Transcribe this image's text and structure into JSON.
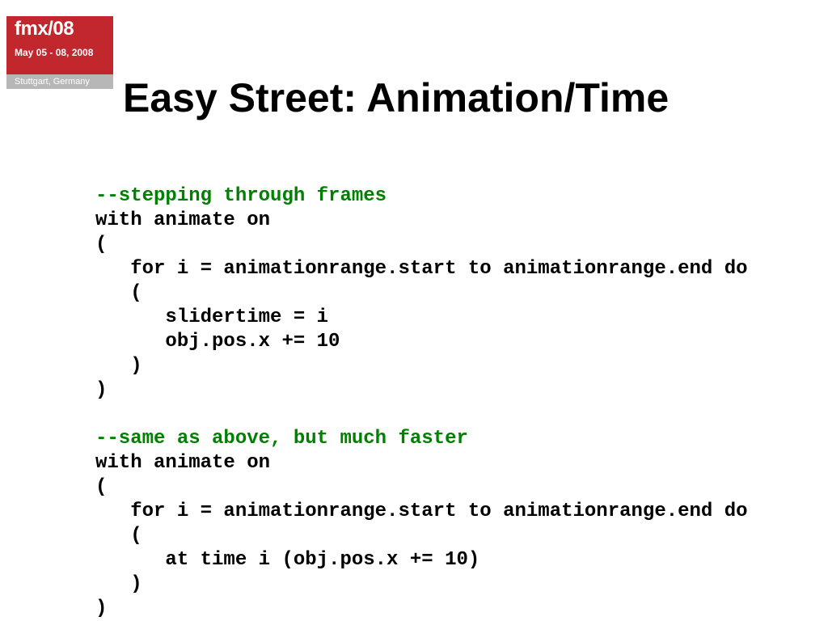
{
  "logo": {
    "title": "fmx/08",
    "dates": "May 05 - 08, 2008",
    "location": "Stuttgart, Germany"
  },
  "slide": {
    "title": "Easy Street: Animation/Time"
  },
  "code": {
    "comment1": "--stepping through frames",
    "block1_l1": "with animate on",
    "block1_l2": "(",
    "block1_l3": "   for i = animationrange.start to animationrange.end do",
    "block1_l4": "   (",
    "block1_l5": "      slidertime = i",
    "block1_l6": "      obj.pos.x += 10",
    "block1_l7": "   )",
    "block1_l8": ")",
    "comment2": "--same as above, but much faster",
    "block2_l1": "with animate on",
    "block2_l2": "(",
    "block2_l3": "   for i = animationrange.start to animationrange.end do",
    "block2_l4": "   (",
    "block2_l5": "      at time i (obj.pos.x += 10)",
    "block2_l6": "   )",
    "block2_l7": ")"
  }
}
